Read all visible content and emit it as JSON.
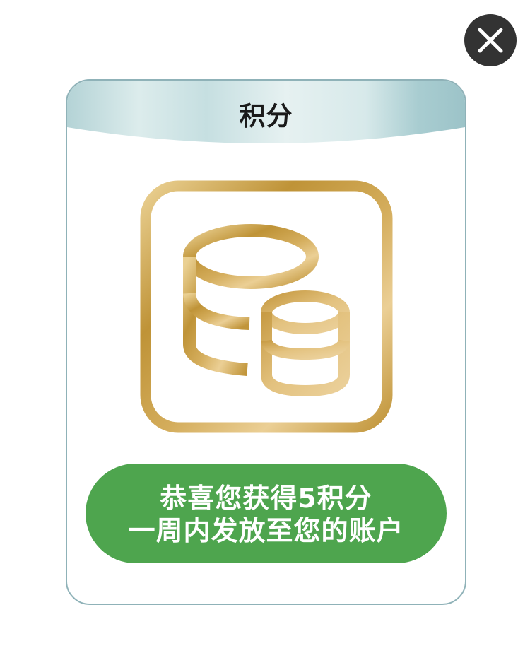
{
  "dialog": {
    "title": "积分",
    "message_line1": "恭喜您获得5积分",
    "message_line2": "一周内发放至您的账户",
    "close_icon": "close-icon",
    "points_icon": "coin-stack-icon"
  },
  "colors": {
    "close_button_bg": "#333333",
    "card_border": "#8fb2b8",
    "header_gradient_light": "#dfeeee",
    "header_gradient_dark": "#9fc6cb",
    "icon_gold_dark": "#bd9036",
    "icon_gold_light": "#ebcf95",
    "message_bg": "#4ea54e",
    "message_text": "#ffffff"
  }
}
